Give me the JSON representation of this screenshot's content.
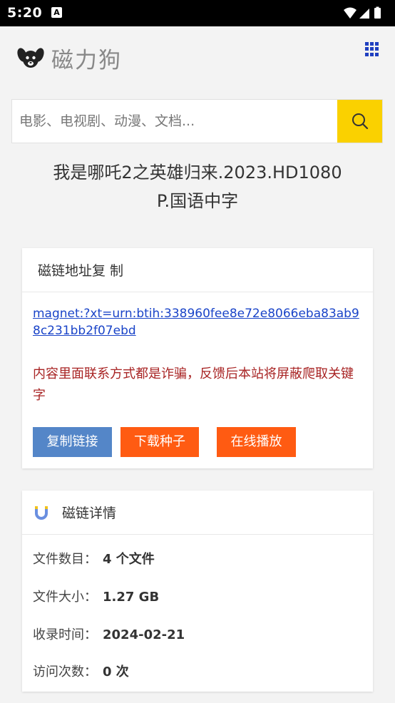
{
  "status_bar": {
    "time": "5:20",
    "notification_letter": "A"
  },
  "header": {
    "logo_text": "磁力狗"
  },
  "search": {
    "placeholder": "电影、电视剧、动漫、文档..."
  },
  "title": {
    "line1": "我是哪吒2之英雄归来.2023.HD1080",
    "line2": "P.国语中字"
  },
  "magnet_card": {
    "header": "磁链地址复 制",
    "link": "magnet:?xt=urn:btih:338960fee8e72e8066eba83ab98c231bb2f07ebd",
    "warning": "内容里面联系方式都是诈骗，反馈后本站将屏蔽爬取关键字",
    "buttons": {
      "copy": "复制链接",
      "torrent": "下载种子",
      "play": "在线播放"
    }
  },
  "details_card": {
    "header": "磁链详情",
    "file_count_label": "文件数目：",
    "file_count": "4 个文件",
    "file_size_label": "文件大小：",
    "file_size": "1.27 GB",
    "indexed_label": "收录时间：",
    "indexed": "2024-02-21",
    "visits_label": "访问次数：",
    "visits": "0 次"
  },
  "colors": {
    "search_button": "#fad100",
    "copy_button": "#5486c8",
    "action_button": "#ff5b12",
    "link": "#1a44c8",
    "warning": "#a82424",
    "menu_icon": "#1f3fc0"
  },
  "icons": [
    "dog-logo-icon",
    "grid-menu-icon",
    "search-icon",
    "magnet-icon",
    "wifi-icon",
    "signal-icon",
    "battery-icon"
  ]
}
